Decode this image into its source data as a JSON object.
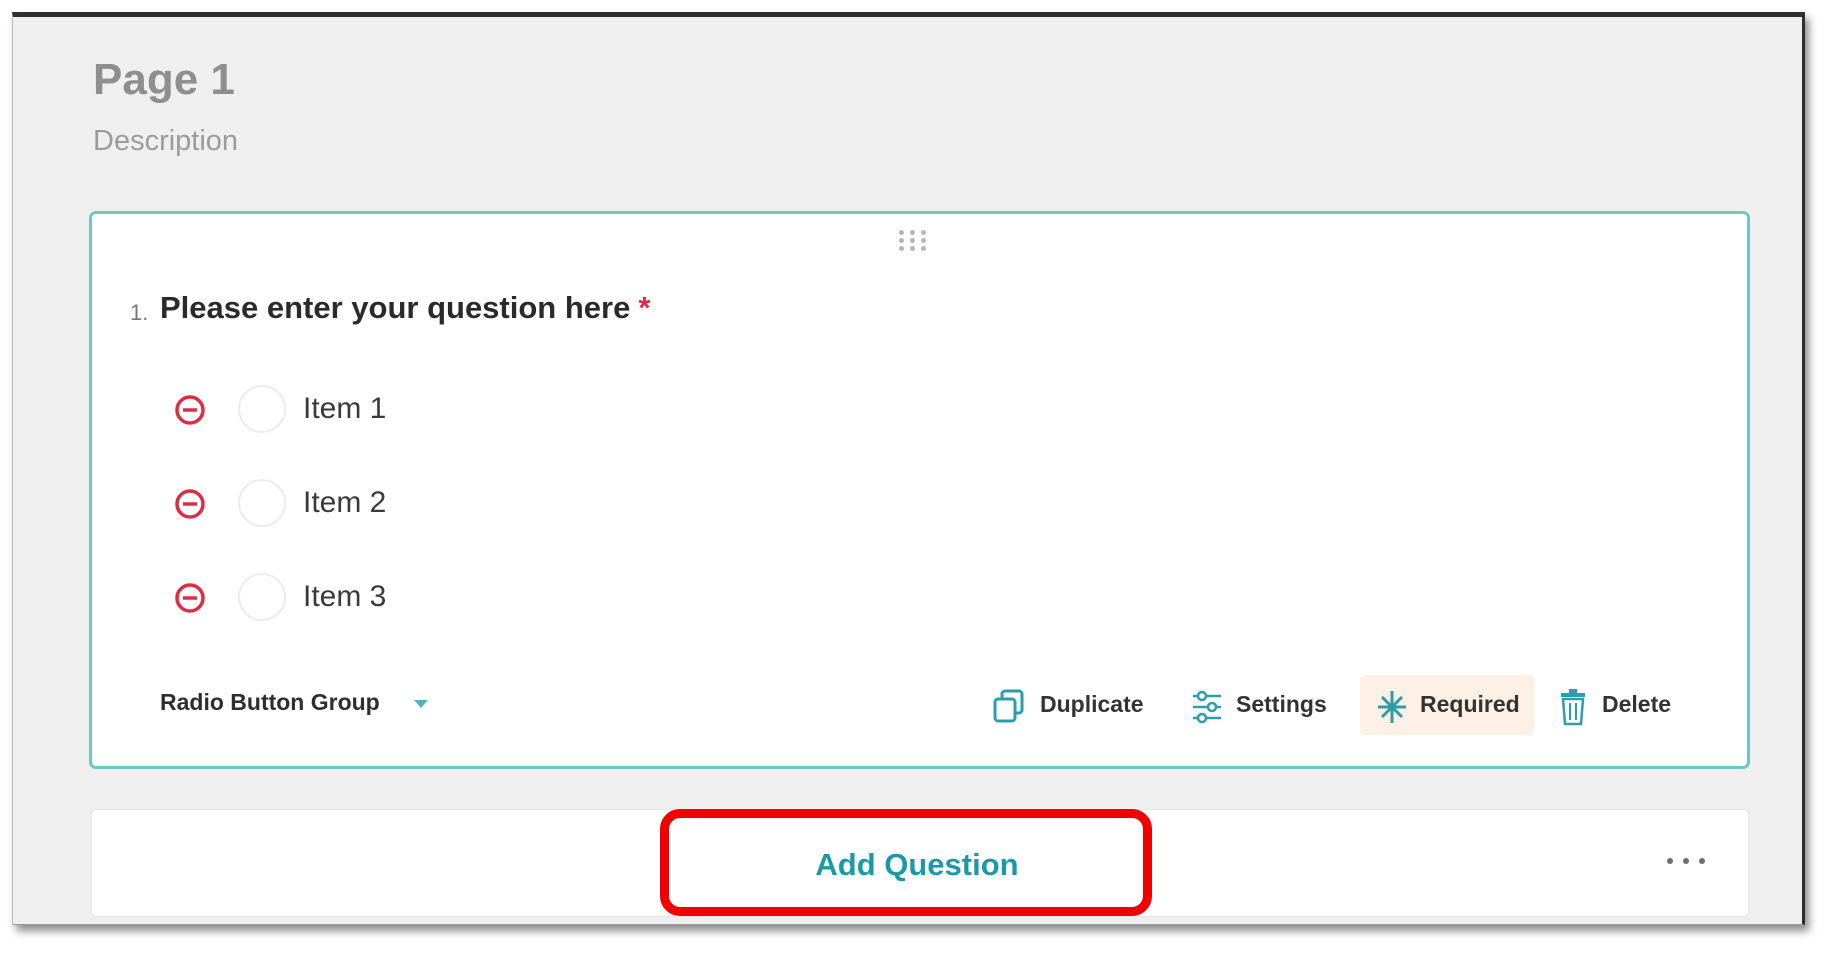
{
  "page": {
    "title": "Page 1",
    "description": "Description"
  },
  "question": {
    "number": "1.",
    "title": "Please enter your question here",
    "required_marker": "*",
    "choices": [
      {
        "label": "Item 1"
      },
      {
        "label": "Item 2"
      },
      {
        "label": "Item 3"
      }
    ],
    "type_label": "Radio Button Group",
    "actions": {
      "duplicate": "Duplicate",
      "settings": "Settings",
      "required": "Required",
      "delete": "Delete"
    }
  },
  "add_bar": {
    "add_question_label": "Add Question"
  },
  "colors": {
    "accent": "#1a9aa7",
    "card_border": "#73c4c8",
    "remove": "#e02b45",
    "required_bg": "#fdf0e4",
    "highlight": "#f20000"
  },
  "icons": {
    "drag": "drag-handle-icon",
    "remove": "remove-circle-icon",
    "duplicate": "duplicate-icon",
    "settings": "sliders-icon",
    "required": "asterisk-icon",
    "delete": "trash-icon",
    "more": "more-horizontal-icon",
    "chevron": "chevron-down-icon"
  }
}
